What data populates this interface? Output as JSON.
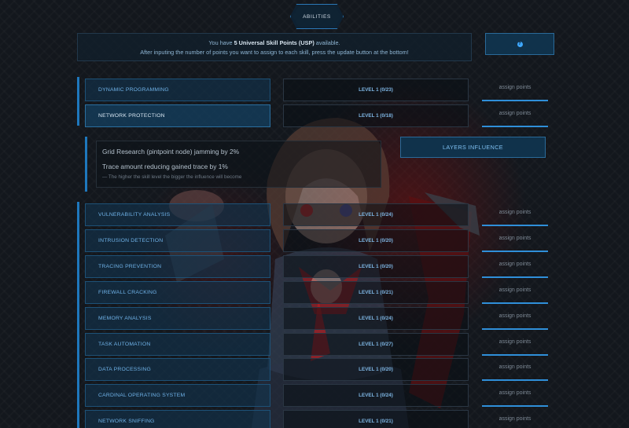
{
  "header": {
    "tab_label": "ABILITIES"
  },
  "info": {
    "line1_prefix": "You have",
    "line1_bold": "5 Universal Skill Points (USP)",
    "line1_suffix": "available.",
    "line2": "After inputing the number of points you want to assign to each skill, press the update button at the bottom!"
  },
  "help_button": {
    "icon": "question-circle-icon",
    "glyph": "?"
  },
  "group1": {
    "skills": [
      {
        "name": "DYNAMIC PROGRAMMING",
        "level": "LEVEL 1 (0/23)",
        "assign": "assign points",
        "selected": false
      },
      {
        "name": "NETWORK PROTECTION",
        "level": "LEVEL 1 (0/18)",
        "assign": "assign points",
        "selected": true
      }
    ]
  },
  "influence": {
    "line1": "Grid Research (pintpoint node) jamming by 2%",
    "line2": "Trace amount reducing gained trace by 1%",
    "note": "— The higher the skill level the bigger the influence will become",
    "button_label": "LAYERS INFLUENCE"
  },
  "group2": {
    "skills": [
      {
        "name": "VULNERABILITY ANALYSIS",
        "level": "LEVEL 1 (0/24)",
        "assign": "assign points"
      },
      {
        "name": "INTRUSION DETECTION",
        "level": "LEVEL 1 (0/20)",
        "assign": "assign points"
      },
      {
        "name": "TRACING PREVENTION",
        "level": "LEVEL 1 (0/20)",
        "assign": "assign points"
      },
      {
        "name": "FIREWALL CRACKING",
        "level": "LEVEL 1 (0/21)",
        "assign": "assign points"
      },
      {
        "name": "MEMORY ANALYSIS",
        "level": "LEVEL 1 (0/24)",
        "assign": "assign points"
      },
      {
        "name": "TASK AUTOMATION",
        "level": "LEVEL 1 (0/27)",
        "assign": "assign points"
      },
      {
        "name": "DATA PROCESSING",
        "level": "LEVEL 1 (0/20)",
        "assign": "assign points"
      },
      {
        "name": "CARDINAL OPERATING SYSTEM",
        "level": "LEVEL 1 (0/24)",
        "assign": "assign points"
      },
      {
        "name": "NETWORK SNIFFING",
        "level": "LEVEL 1 (0/21)",
        "assign": "assign points"
      }
    ]
  },
  "colors": {
    "accent": "#1e78bd",
    "panel": "#10324b",
    "text_accent": "#6fb2e8"
  }
}
